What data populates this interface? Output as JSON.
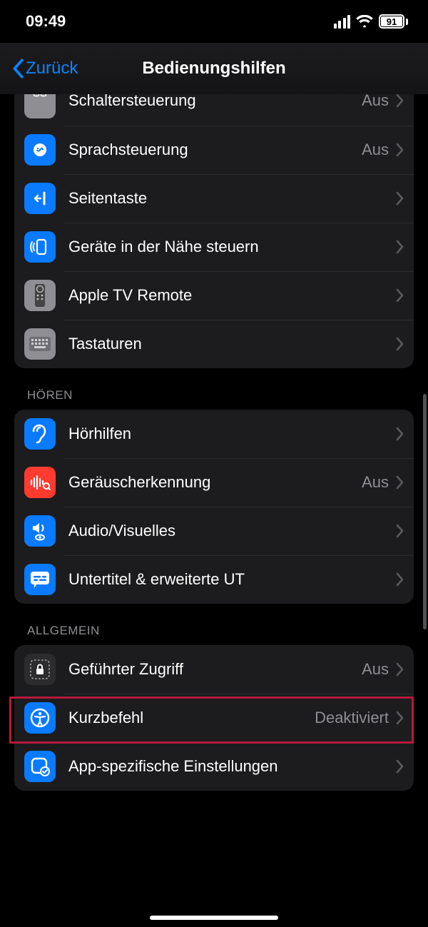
{
  "status": {
    "time": "09:49",
    "battery": "91"
  },
  "nav": {
    "back": "Zurück",
    "title": "Bedienungshilfen"
  },
  "sections": {
    "physical": {
      "items": [
        {
          "label": "Schaltersteuerung",
          "detail": "Aus"
        },
        {
          "label": "Sprachsteuerung",
          "detail": "Aus"
        },
        {
          "label": "Seitentaste",
          "detail": ""
        },
        {
          "label": "Geräte in der Nähe steuern",
          "detail": ""
        },
        {
          "label": "Apple TV Remote",
          "detail": ""
        },
        {
          "label": "Tastaturen",
          "detail": ""
        }
      ]
    },
    "hearing": {
      "header": "Hören",
      "items": [
        {
          "label": "Hörhilfen",
          "detail": ""
        },
        {
          "label": "Geräuscherkennung",
          "detail": "Aus"
        },
        {
          "label": "Audio/Visuelles",
          "detail": ""
        },
        {
          "label": "Untertitel & erweiterte UT",
          "detail": ""
        }
      ]
    },
    "general": {
      "header": "Allgemein",
      "items": [
        {
          "label": "Geführter Zugriff",
          "detail": "Aus"
        },
        {
          "label": "Kurzbefehl",
          "detail": "Deaktiviert"
        },
        {
          "label": "App-spezifische Einstellungen",
          "detail": ""
        }
      ]
    }
  }
}
